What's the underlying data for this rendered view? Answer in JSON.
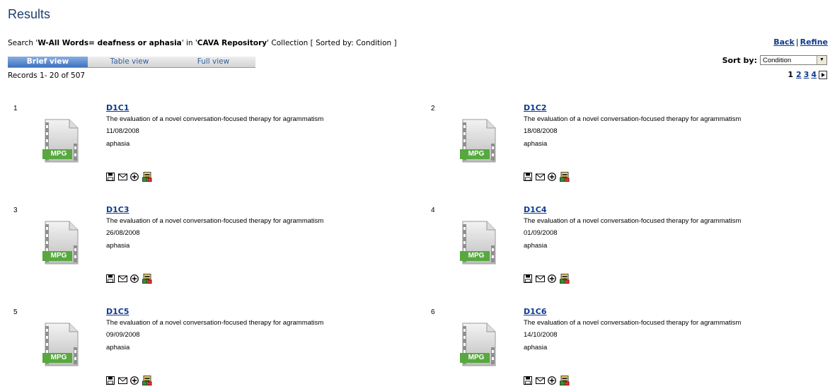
{
  "header": {
    "title": "Results"
  },
  "search": {
    "prefix": "Search '",
    "query": "W-All Words= deafness or aphasia",
    "middle": "' in '",
    "collection": "CAVA Repository",
    "suffix": "' Collection [ Sorted by: Condition ]"
  },
  "links": {
    "back": "Back",
    "separator": "|",
    "refine": "Refine"
  },
  "tabs": [
    {
      "label": "Brief view",
      "active": true
    },
    {
      "label": "Table view",
      "active": false
    },
    {
      "label": "Full view",
      "active": false
    }
  ],
  "sort": {
    "label": "Sort by:",
    "selected": "Condition"
  },
  "records_info": "Records 1- 20 of 507",
  "pagination": {
    "current": "1",
    "pages": [
      "2",
      "3",
      "4"
    ]
  },
  "thumbnail_label": "MPG",
  "records": [
    {
      "num": "1",
      "id": "D1C1",
      "title": "The evaluation of a novel conversation-focused therapy for agrammatism",
      "date": "11/08/2008",
      "condition": "aphasia"
    },
    {
      "num": "2",
      "id": "D1C2",
      "title": "The evaluation of a novel conversation-focused therapy for agrammatism",
      "date": "18/08/2008",
      "condition": "aphasia"
    },
    {
      "num": "3",
      "id": "D1C3",
      "title": "The evaluation of a novel conversation-focused therapy for agrammatism",
      "date": "26/08/2008",
      "condition": "aphasia"
    },
    {
      "num": "4",
      "id": "D1C4",
      "title": "The evaluation of a novel conversation-focused therapy for agrammatism",
      "date": "01/09/2008",
      "condition": "aphasia"
    },
    {
      "num": "5",
      "id": "D1C5",
      "title": "The evaluation of a novel conversation-focused therapy for agrammatism",
      "date": "09/09/2008",
      "condition": "aphasia"
    },
    {
      "num": "6",
      "id": "D1C6",
      "title": "The evaluation of a novel conversation-focused therapy for agrammatism",
      "date": "14/10/2008",
      "condition": "aphasia"
    }
  ],
  "action_icons": [
    "save-icon",
    "email-icon",
    "add-icon",
    "export-icon"
  ]
}
